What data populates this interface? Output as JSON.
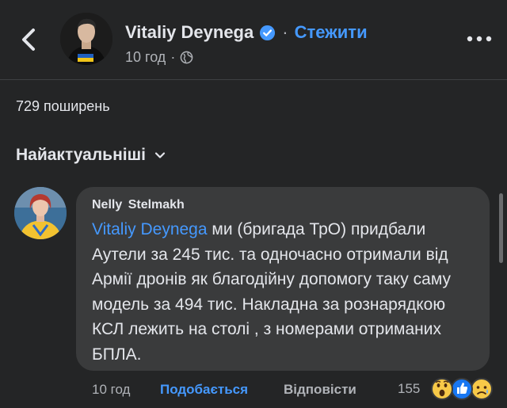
{
  "post": {
    "author_name": "Vitaliy Deynega",
    "separator": "·",
    "follow_label": "Стежити",
    "time": "10 год",
    "meta_separator": "·",
    "verified_color": "#4599ff"
  },
  "icons": {
    "back": "chevron-left-icon",
    "verified": "verified-badge-icon",
    "privacy": "globe-icon",
    "more": "more-horizontal-icon",
    "sort": "chevron-down-icon",
    "reactions": [
      "wow-reaction-icon",
      "like-reaction-icon",
      "sad-reaction-icon"
    ]
  },
  "shares_label": "729 поширень",
  "sort_label": "Найактуальніші",
  "comment": {
    "author": "Nelly  Stelmakh",
    "mention": "Vitaliy Deynega",
    "text": " ми  (бригада ТрО) придбали Аутели за 245 тис. та одночасно отримали від Армії дронів як благодійну допомогу таку саму модель за 494 тис. Накладна за рознарядкою КСЛ лежить на столі , з номерами отриманих БПЛА.",
    "time": "10 год",
    "like_label": "Подобається",
    "reply_label": "Відповісти",
    "reactions_count": "155"
  },
  "colors": {
    "background": "#242526",
    "bubble": "#3a3b3c",
    "link": "#4599ff",
    "text": "#e4e6eb",
    "secondary": "#b0b3b8"
  }
}
